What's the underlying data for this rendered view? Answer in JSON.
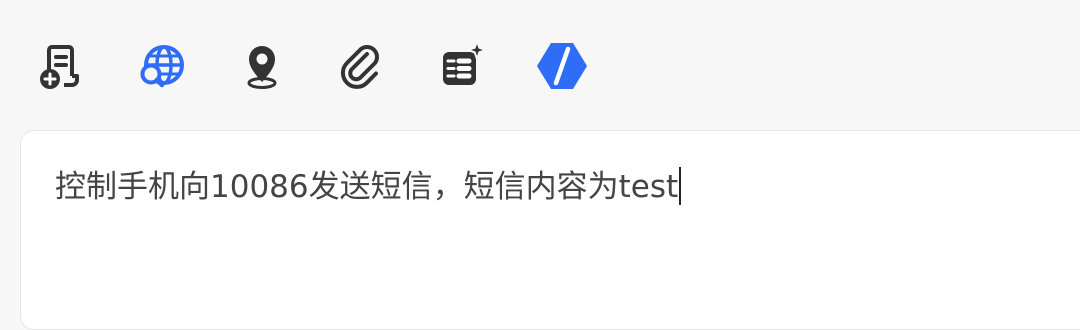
{
  "toolbar": {
    "items": [
      {
        "icon": "document-add-icon",
        "color": "#333333"
      },
      {
        "icon": "web-search-icon",
        "color": "#2f6df6"
      },
      {
        "icon": "location-pin-icon",
        "color": "#333333"
      },
      {
        "icon": "paperclip-icon",
        "color": "#333333"
      },
      {
        "icon": "ai-tools-icon",
        "color": "#333333"
      },
      {
        "icon": "brand-logo-icon",
        "color": "#2f6df6"
      }
    ]
  },
  "input": {
    "value": "控制手机向10086发送短信，短信内容为test"
  }
}
